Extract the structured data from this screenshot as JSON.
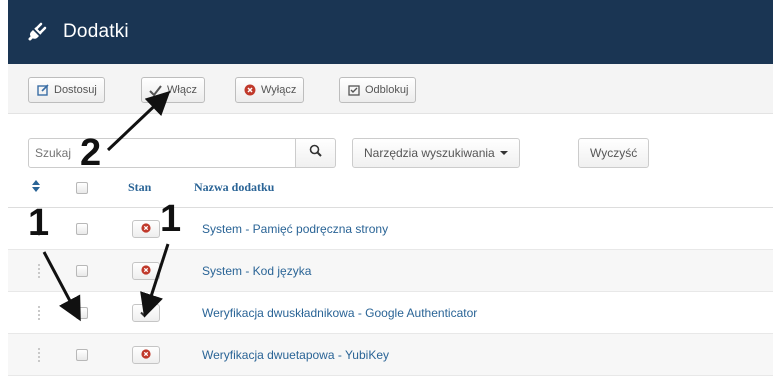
{
  "header": {
    "title": "Dodatki",
    "icon": "plug-icon"
  },
  "toolbar": {
    "buttons": [
      {
        "label": "Dostosuj",
        "icon": "edit-icon"
      },
      {
        "label": "Włącz",
        "icon": "check-icon"
      },
      {
        "label": "Wyłącz",
        "icon": "times-circle-icon"
      },
      {
        "label": "Odblokuj",
        "icon": "unlock-icon"
      }
    ]
  },
  "filters": {
    "search_placeholder": "Szukaj",
    "search_tools_label": "Narzędzia wyszukiwania",
    "clear_label": "Wyczyść"
  },
  "table": {
    "headers": {
      "status": "Stan",
      "name": "Nazwa dodatku"
    },
    "rows": [
      {
        "name": "System - Pamięć podręczna strony",
        "status": "disabled"
      },
      {
        "name": "System - Kod języka",
        "status": "disabled"
      },
      {
        "name": "Weryfikacja dwuskładnikowa - Google Authenticator",
        "status": "enabled"
      },
      {
        "name": "Weryfikacja dwuetapowa - YubiKey",
        "status": "disabled"
      }
    ]
  },
  "annotations": {
    "step1": "1",
    "step2": "2"
  },
  "colors": {
    "header_bg": "#1a3553",
    "link": "#2a6496",
    "disabled_red": "#c0392b"
  }
}
